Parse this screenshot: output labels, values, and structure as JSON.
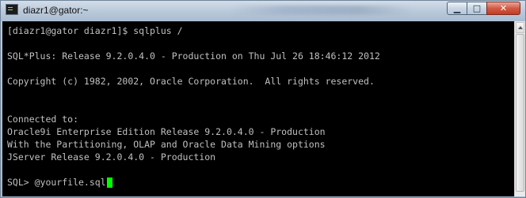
{
  "window": {
    "title": "diazr1@gator:~",
    "controls": {
      "minimize_label": "▁",
      "maximize_label": "□",
      "close_label": "✕"
    }
  },
  "terminal": {
    "lines": [
      "[diazr1@gator diazr1]$ sqlplus /",
      "",
      "SQL*Plus: Release 9.2.0.4.0 - Production on Thu Jul 26 18:46:12 2012",
      "",
      "Copyright (c) 1982, 2002, Oracle Corporation.  All rights reserved.",
      "",
      "",
      "Connected to:",
      "Oracle9i Enterprise Edition Release 9.2.0.4.0 - Production",
      "With the Partitioning, OLAP and Oracle Data Mining options",
      "JServer Release 9.2.0.4.0 - Production",
      ""
    ],
    "prompt": "SQL> @yourfile.sql",
    "cursor_color": "#00ff00",
    "text_color": "#c0c0c0",
    "background_color": "#000000"
  },
  "icons": {
    "app": "terminal-icon",
    "minimize": "minimize-icon",
    "maximize": "maximize-icon",
    "close": "close-icon"
  }
}
